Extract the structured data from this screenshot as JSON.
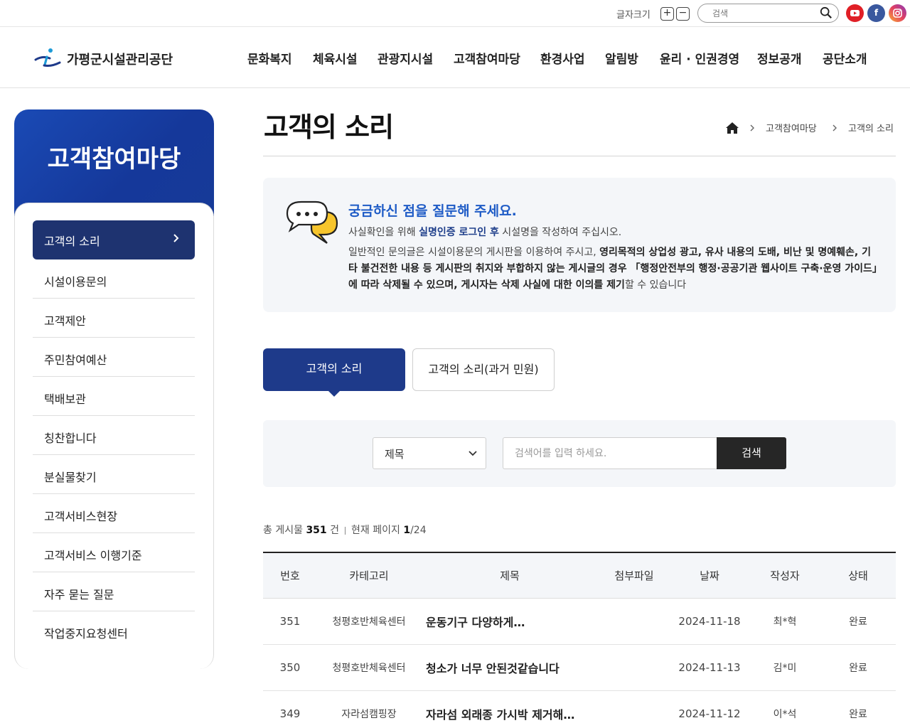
{
  "utility": {
    "font_size_label": "글자크기",
    "plus": "+",
    "minus": "−",
    "search_placeholder": "검색",
    "sns": [
      "youtube-icon",
      "facebook-icon",
      "instagram-icon"
    ]
  },
  "header": {
    "logo_text": "가평군시설관리공단",
    "nav": [
      "문화복지",
      "체육시설",
      "관광지시설",
      "고객참여마당",
      "환경사업",
      "알림방",
      "윤리 · 인권경영",
      "정보공개",
      "공단소개"
    ]
  },
  "sidebar": {
    "title": "고객참여마당",
    "active": "고객의 소리",
    "items": [
      "시설이용문의",
      "고객제안",
      "주민참여예산",
      "택배보관",
      "칭찬합니다",
      "분실물찾기",
      "고객서비스현장",
      "고객서비스 이행기준",
      "자주 묻는 질문",
      "작업중지요청센터"
    ]
  },
  "page": {
    "title": "고객의 소리",
    "breadcrumb": [
      "고객참여마당",
      "고객의 소리"
    ]
  },
  "notice": {
    "title": "궁금하신 점을 질문해 주세요.",
    "line1_pre": "사실확인을 위해 ",
    "line1_bold": "실명인증 로그인 후",
    "line1_post": " 시설명을 작성하여 주십시오.",
    "para_pre": "일반적인 문의글은 시설이용문의 게시판을 이용하여 주시고, ",
    "para_bold": "영리목적의 상업성 광고, 유사 내용의 도배, 비난 및 명예훼손, 기타 불건전한 내용 등 게시판의 취지와 부합하지 않는 게시글의 경우 「행정안전부의 행정·공공기관 웹사이트 구축·운영 가이드」에 따라 삭제될 수 있으며, 게시자는 삭제 사실에 대한 이의를 제기",
    "para_post": "할 수 있습니다"
  },
  "tabs": [
    "고객의 소리",
    "고객의 소리(과거 민원)"
  ],
  "search": {
    "select_value": "제목",
    "placeholder": "검색어를 입력 하세요.",
    "button": "검색"
  },
  "count": {
    "total_label": "총 게시물",
    "total": "351",
    "total_unit": "건",
    "page_label": "현재 페이지",
    "page_current": "1",
    "page_total": "/24"
  },
  "table": {
    "headers": [
      "번호",
      "카테고리",
      "제목",
      "첨부파일",
      "날짜",
      "작성자",
      "상태"
    ],
    "rows": [
      {
        "no": "351",
        "category": "청평호반체육센터",
        "title": "운동기구 다양하게…",
        "file": "",
        "date": "2024-11-18",
        "writer": "최*혁",
        "state": "완료"
      },
      {
        "no": "350",
        "category": "청평호반체육센터",
        "title": "청소가 너무 안된것같습니다",
        "file": "",
        "date": "2024-11-13",
        "writer": "김*미",
        "state": "완료"
      },
      {
        "no": "349",
        "category": "자라섬캠핑장",
        "title": "자라섬 외래종 가시박 제거해…",
        "file": "",
        "date": "2024-11-12",
        "writer": "이*석",
        "state": "완료"
      }
    ]
  },
  "colors": {
    "primary_navy": "#1e3a8a",
    "sidebar_active": "#1e3370",
    "notice_title": "#1e5bc6"
  }
}
